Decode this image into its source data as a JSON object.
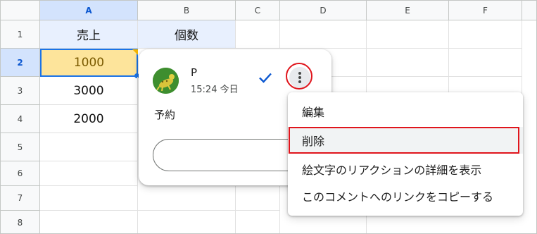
{
  "sheet": {
    "columns": [
      "A",
      "B",
      "C",
      "D",
      "E",
      "F"
    ],
    "rows": [
      "1",
      "2",
      "3",
      "4",
      "5",
      "6",
      "7",
      "8"
    ],
    "cells": {
      "a1": "売上",
      "b1": "個数",
      "a2": "1000",
      "a3": "3000",
      "a4": "2000"
    }
  },
  "comment": {
    "author": "P",
    "time": "15:24 今日",
    "text": "予約",
    "reply_placeholder": ""
  },
  "menu": {
    "items": [
      "編集",
      "削除",
      "絵文字のリアクションの詳細を表示",
      "このコメントへのリンクをコピーする"
    ]
  },
  "colors": {
    "selection": "#1a73e8",
    "highlight_ring": "#e0151c",
    "active_cell": "#fde49b",
    "header_fill": "#e8f0fe"
  },
  "icons": [
    "resolve-check-icon",
    "more-vert-icon",
    "avatar-icon"
  ]
}
